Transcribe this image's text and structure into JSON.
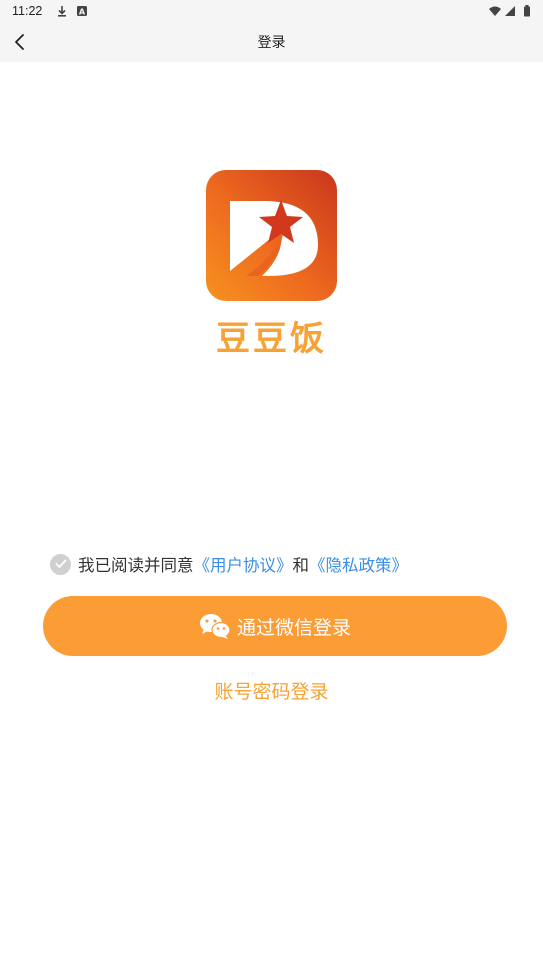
{
  "status_bar": {
    "time": "11:22",
    "icons": [
      "download-icon",
      "a-icon",
      "wifi-icon",
      "signal-icon",
      "battery-icon"
    ]
  },
  "header": {
    "title": "登录",
    "back_icon": "chevron-left-icon"
  },
  "logo": {
    "icon": "app-logo-d-star",
    "app_name": "豆豆饭"
  },
  "agreement": {
    "checked": false,
    "prefix": "我已阅读并同意",
    "user_agreement": "《用户协议》",
    "and": "和",
    "privacy_policy": "《隐私政策》"
  },
  "login": {
    "wechat_label": "通过微信登录",
    "wechat_icon": "wechat-icon",
    "account_label": "账号密码登录"
  },
  "colors": {
    "accent": "#fb9c35",
    "brand_text": "#f7a234",
    "link": "#3a8ee6",
    "app_bar_bg": "#f5f5f5"
  }
}
